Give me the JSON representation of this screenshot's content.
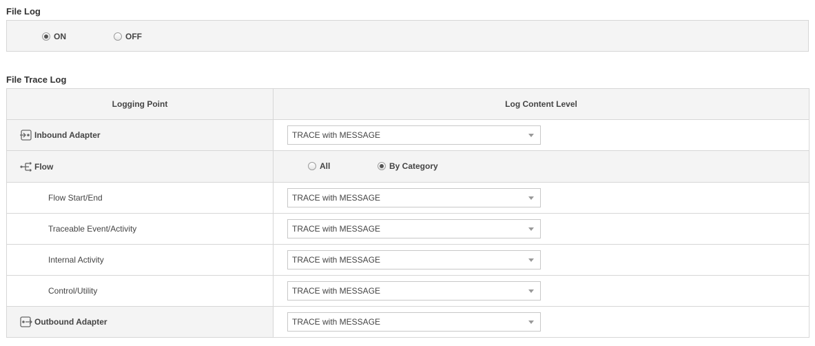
{
  "file_log": {
    "title": "File Log",
    "options": [
      {
        "label": "ON",
        "checked": true
      },
      {
        "label": "OFF",
        "checked": false
      }
    ]
  },
  "file_trace_log": {
    "title": "File Trace Log",
    "headers": {
      "logging_point": "Logging Point",
      "log_content_level": "Log Content Level"
    },
    "inbound": {
      "label": "Inbound Adapter",
      "icon": "inbound-adapter-icon",
      "value": "TRACE with MESSAGE"
    },
    "flow": {
      "label": "Flow",
      "icon": "flow-icon",
      "options": [
        {
          "label": "All",
          "checked": false
        },
        {
          "label": "By Category",
          "checked": true
        }
      ],
      "categories": [
        {
          "label": "Flow Start/End",
          "value": "TRACE with MESSAGE"
        },
        {
          "label": "Traceable Event/Activity",
          "value": "TRACE with MESSAGE"
        },
        {
          "label": "Internal Activity",
          "value": "TRACE with MESSAGE"
        },
        {
          "label": "Control/Utility",
          "value": "TRACE with MESSAGE"
        }
      ]
    },
    "outbound": {
      "label": "Outbound Adapter",
      "icon": "outbound-adapter-icon",
      "value": "TRACE with MESSAGE"
    }
  }
}
